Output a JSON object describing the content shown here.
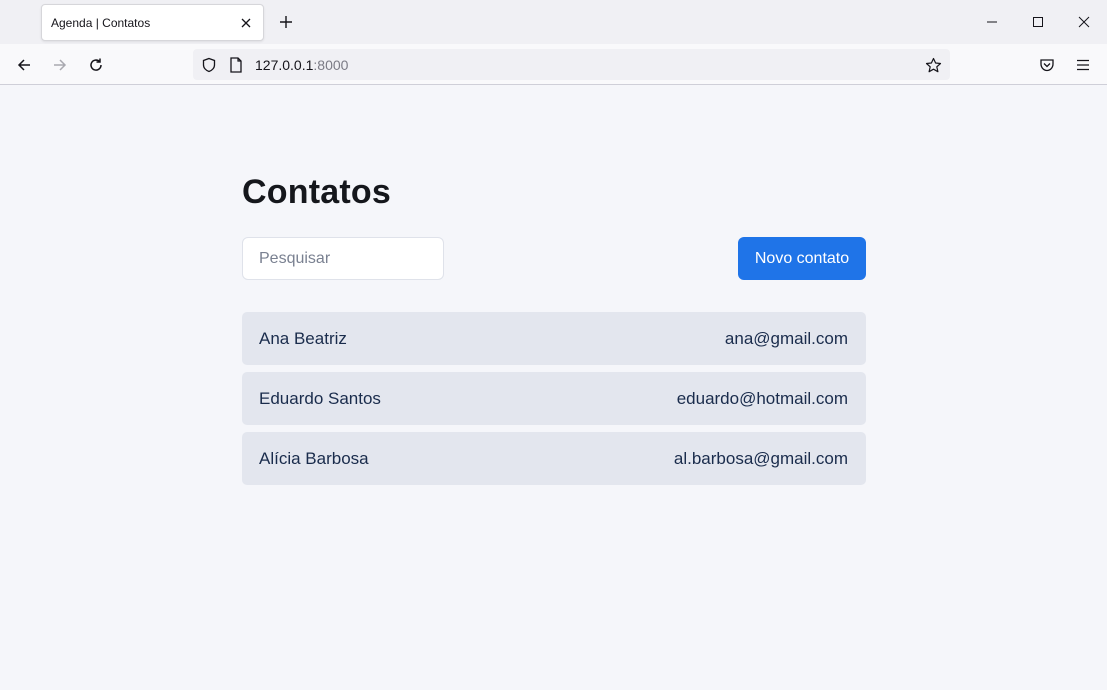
{
  "browser": {
    "tab_title": "Agenda | Contatos",
    "url_host": "127.0.0.1",
    "url_port": ":8000"
  },
  "page": {
    "title": "Contatos",
    "search_placeholder": "Pesquisar",
    "new_contact_label": "Novo contato"
  },
  "contacts": [
    {
      "name": "Ana Beatriz",
      "email": "ana@gmail.com"
    },
    {
      "name": "Eduardo Santos",
      "email": "eduardo@hotmail.com"
    },
    {
      "name": "Alícia Barbosa",
      "email": "al.barbosa@gmail.com"
    }
  ],
  "colors": {
    "accent": "#1f74e8",
    "row_background": "#e3e6ee",
    "page_background": "#f5f6fa"
  }
}
